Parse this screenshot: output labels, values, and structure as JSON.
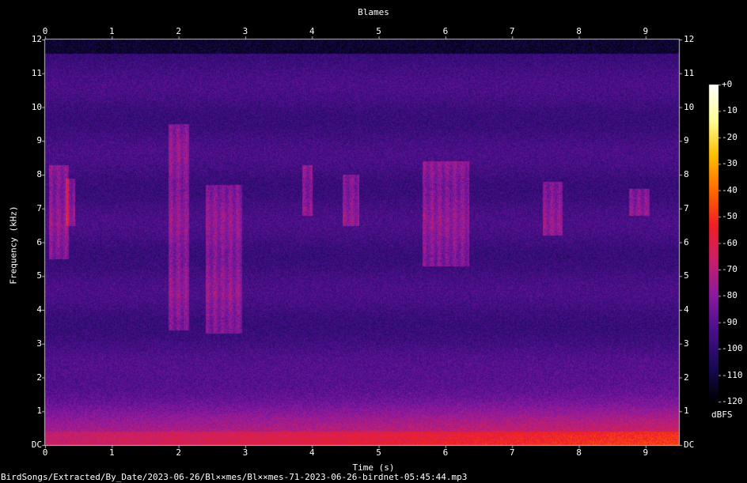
{
  "chart_data": {
    "type": "heatmap",
    "subtype": "spectrogram",
    "title": "Blames",
    "xlabel": "Time (s)",
    "ylabel": "Frequency (kHz)",
    "xlim": [
      0,
      9.5
    ],
    "ylim": [
      0,
      12
    ],
    "x_ticks": [
      "0",
      "1",
      "2",
      "3",
      "4",
      "5",
      "6",
      "7",
      "8",
      "9"
    ],
    "y_ticks": [
      "DC",
      "1",
      "2",
      "3",
      "4",
      "5",
      "6",
      "7",
      "8",
      "9",
      "10",
      "11",
      "12"
    ],
    "colorbar": {
      "label": "dBFS",
      "range": [
        -120,
        0
      ],
      "ticks": [
        "+0",
        "-10",
        "-20",
        "-30",
        "-40",
        "-50",
        "-60",
        "-70",
        "-80",
        "-90",
        "-100",
        "-110",
        "-120"
      ],
      "colors": [
        "#000000",
        "#1a0a5a",
        "#4a0f8a",
        "#8a1aa0",
        "#c8206a",
        "#f01e28",
        "#ff6a00",
        "#ffc000",
        "#ffff99",
        "#ffffff"
      ]
    },
    "bird_calls": [
      {
        "t_start": 0.05,
        "t_end": 0.35,
        "f_low": 5.5,
        "f_high": 8.3
      },
      {
        "t_start": 0.3,
        "t_end": 0.45,
        "f_low": 6.5,
        "f_high": 7.9
      },
      {
        "t_start": 1.85,
        "t_end": 2.15,
        "f_low": 3.4,
        "f_high": 9.5
      },
      {
        "t_start": 2.4,
        "t_end": 2.95,
        "f_low": 3.3,
        "f_high": 7.7
      },
      {
        "t_start": 3.85,
        "t_end": 4.0,
        "f_low": 6.8,
        "f_high": 8.3
      },
      {
        "t_start": 4.45,
        "t_end": 4.7,
        "f_low": 6.5,
        "f_high": 8.0
      },
      {
        "t_start": 5.65,
        "t_end": 6.35,
        "f_low": 5.3,
        "f_high": 8.4
      },
      {
        "t_start": 7.45,
        "t_end": 7.75,
        "f_low": 6.2,
        "f_high": 7.8
      },
      {
        "t_start": 8.75,
        "t_end": 9.05,
        "f_low": 6.8,
        "f_high": 7.6
      }
    ]
  },
  "title": "Blames",
  "xlabel": "Time (s)",
  "ylabel": "Frequency (kHz)",
  "colorbar_unit": "dBFS",
  "file_path": "BirdSongs/Extracted/By_Date/2023-06-26/Bl××mes/Bl××mes-71-2023-06-26-birdnet-05:45:44.mp3"
}
